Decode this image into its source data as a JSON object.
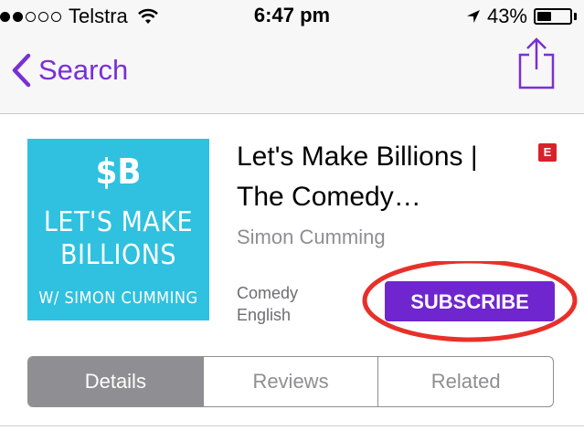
{
  "status_bar": {
    "signal_filled": 2,
    "signal_total": 5,
    "carrier": "Telstra",
    "time": "6:47 pm",
    "battery": "43%",
    "battery_level": 0.43
  },
  "nav": {
    "back_label": "Search",
    "accent_color": "#7a2fd6"
  },
  "artwork": {
    "logo": "$B",
    "line1": "LET'S MAKE",
    "line2": "BILLIONS",
    "sub": "W/ SIMON CUMMING",
    "bg_color": "#2fc1df"
  },
  "podcast": {
    "title_line1": "Let's Make Billions |",
    "title_line2": "The Comedy…",
    "explicit_badge": "E",
    "author": "Simon Cumming",
    "genre": "Comedy",
    "language": "English"
  },
  "subscribe": {
    "label": "SUBSCRIBE",
    "color": "#6f26cf",
    "highlight_color": "#e8302a"
  },
  "segments": {
    "items": [
      "Details",
      "Reviews",
      "Related"
    ],
    "active": "Details"
  }
}
